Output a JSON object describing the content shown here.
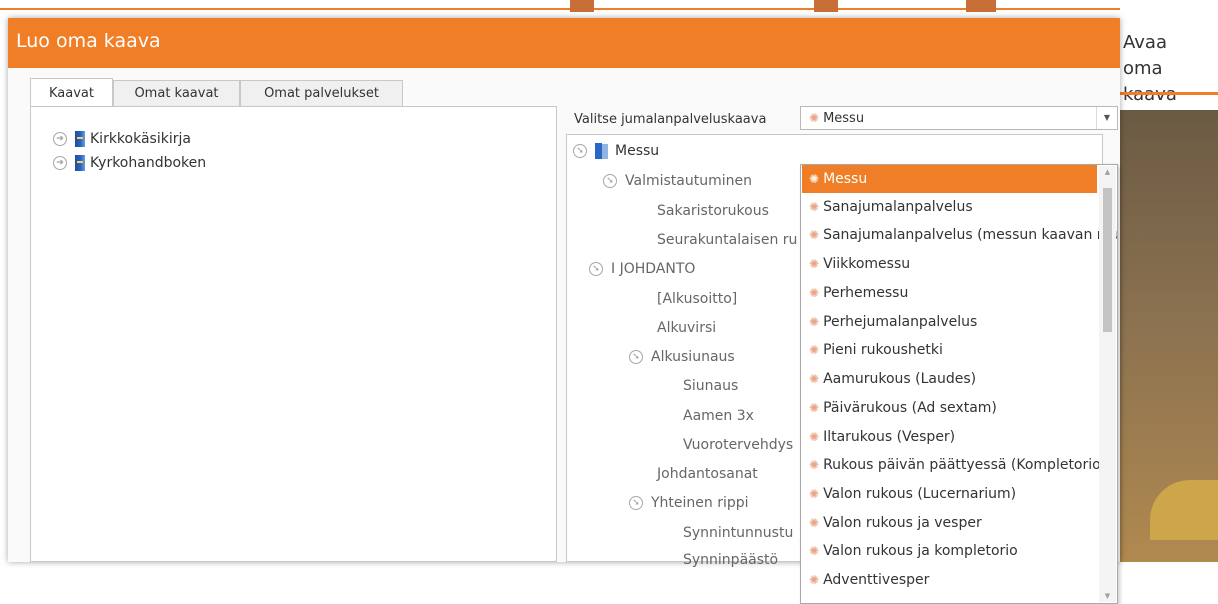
{
  "dialog": {
    "title": "Luo oma kaava"
  },
  "background": {
    "right_title": "Avaa\noma kaava"
  },
  "tabs": [
    {
      "label": "Kaavat",
      "active": true
    },
    {
      "label": "Omat kaavat",
      "active": false
    },
    {
      "label": "Omat palvelukset",
      "active": false
    }
  ],
  "left_tree": [
    {
      "label": "Kirkkokäsikirja",
      "expander": "collapsed",
      "icon": "book-icon"
    },
    {
      "label": "Kyrkohandboken",
      "expander": "collapsed",
      "icon": "book-icon"
    }
  ],
  "selector": {
    "label": "Valitse jumalanpalveluskaava",
    "value": "Messu",
    "icon": "sun-icon"
  },
  "structure_tree": [
    {
      "label": "Messu",
      "level": 0,
      "expander": "expanded",
      "icon": "open-book-icon"
    },
    {
      "label": "Valmistautuminen",
      "level": 1,
      "expander": "expanded"
    },
    {
      "label": "Sakaristorukous",
      "level": 2
    },
    {
      "label": "Seurakuntalaisen ru",
      "level": 2
    },
    {
      "label": "I JOHDANTO",
      "level": 1,
      "expander": "expanded"
    },
    {
      "label": "[Alkusoitto]",
      "level": 2
    },
    {
      "label": "Alkuvirsi",
      "level": 2
    },
    {
      "label": "Alkusiunaus",
      "level": 2,
      "expander": "expanded"
    },
    {
      "label": "Siunaus",
      "level": 3
    },
    {
      "label": "Aamen 3x",
      "level": 3
    },
    {
      "label": "Vuorotervehdys",
      "level": 3
    },
    {
      "label": "Johdantosanat",
      "level": 2
    },
    {
      "label": "Yhteinen rippi",
      "level": 2,
      "expander": "expanded"
    },
    {
      "label": "Synnintunnustu",
      "level": 3
    },
    {
      "label": "Synninpäästö",
      "level": 3
    }
  ],
  "dropdown": {
    "selected_index": 0,
    "items": [
      "Messu",
      "Sanajumalanpalvelus",
      "Sanajumalanpalvelus (messun kaavan mukaan)",
      "Viikkomessu",
      "Perhemessu",
      "Perhejumalanpalvelus",
      "Pieni rukoushetki",
      "Aamurukous (Laudes)",
      "Päivärukous (Ad sextam)",
      "Iltarukous (Vesper)",
      "Rukous päivän päättyessä (Kompletorio)",
      "Valon rukous (Lucernarium)",
      "Valon rukous ja vesper",
      "Valon rukous ja kompletorio",
      "Adventtivesper"
    ],
    "scrollbar_position": 0.05
  },
  "colors": {
    "accent": "#f07e26",
    "selection_text": "#ffffff",
    "border": "#c8c8c8"
  }
}
